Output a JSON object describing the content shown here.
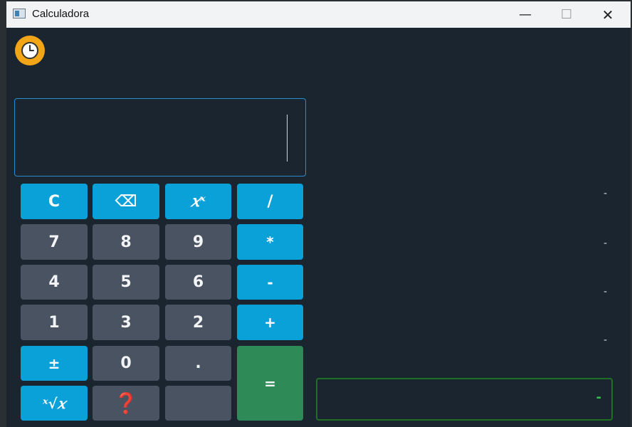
{
  "window": {
    "title": "Calculadora",
    "icon": "calculator-app-icon",
    "controls": {
      "minimize": "—",
      "maximize": "☐",
      "close": "✕"
    }
  },
  "toolbar": {
    "history_icon": "clock-icon",
    "accent": "#f2a516"
  },
  "display": {
    "value": "",
    "border_color": "#2d8bd0"
  },
  "keypad": {
    "clear": "C",
    "backspace": "⌫",
    "power": "𝑥ˣ",
    "divide": "/",
    "seven": "7",
    "eight": "8",
    "nine": "9",
    "multiply": "*",
    "four": "4",
    "five": "5",
    "six": "6",
    "minus": "-",
    "one": "1",
    "three": "3",
    "two": "2",
    "plus": "+",
    "sign": "±",
    "zero": "0",
    "decimal": ".",
    "equals": "=",
    "root": "ˣ√𝑥",
    "help": "❓",
    "blank": ""
  },
  "history": {
    "entries": [
      "-",
      "-",
      "-",
      "-"
    ]
  },
  "result": {
    "value": "-",
    "color": "#2ec44c"
  },
  "colors": {
    "operator": "#0aa0d8",
    "digit": "#4a5361",
    "equals": "#2e8b57",
    "background": "#1b2530"
  }
}
